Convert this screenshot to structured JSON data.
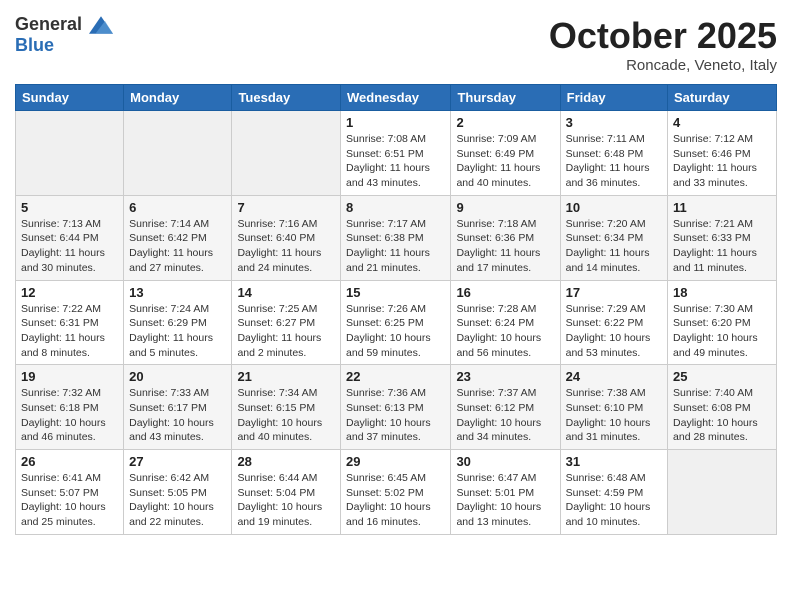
{
  "header": {
    "logo_line1": "General",
    "logo_line2": "Blue",
    "month": "October 2025",
    "location": "Roncade, Veneto, Italy"
  },
  "weekdays": [
    "Sunday",
    "Monday",
    "Tuesday",
    "Wednesday",
    "Thursday",
    "Friday",
    "Saturday"
  ],
  "weeks": [
    [
      {
        "day": "",
        "info": ""
      },
      {
        "day": "",
        "info": ""
      },
      {
        "day": "",
        "info": ""
      },
      {
        "day": "1",
        "info": "Sunrise: 7:08 AM\nSunset: 6:51 PM\nDaylight: 11 hours and 43 minutes."
      },
      {
        "day": "2",
        "info": "Sunrise: 7:09 AM\nSunset: 6:49 PM\nDaylight: 11 hours and 40 minutes."
      },
      {
        "day": "3",
        "info": "Sunrise: 7:11 AM\nSunset: 6:48 PM\nDaylight: 11 hours and 36 minutes."
      },
      {
        "day": "4",
        "info": "Sunrise: 7:12 AM\nSunset: 6:46 PM\nDaylight: 11 hours and 33 minutes."
      }
    ],
    [
      {
        "day": "5",
        "info": "Sunrise: 7:13 AM\nSunset: 6:44 PM\nDaylight: 11 hours and 30 minutes."
      },
      {
        "day": "6",
        "info": "Sunrise: 7:14 AM\nSunset: 6:42 PM\nDaylight: 11 hours and 27 minutes."
      },
      {
        "day": "7",
        "info": "Sunrise: 7:16 AM\nSunset: 6:40 PM\nDaylight: 11 hours and 24 minutes."
      },
      {
        "day": "8",
        "info": "Sunrise: 7:17 AM\nSunset: 6:38 PM\nDaylight: 11 hours and 21 minutes."
      },
      {
        "day": "9",
        "info": "Sunrise: 7:18 AM\nSunset: 6:36 PM\nDaylight: 11 hours and 17 minutes."
      },
      {
        "day": "10",
        "info": "Sunrise: 7:20 AM\nSunset: 6:34 PM\nDaylight: 11 hours and 14 minutes."
      },
      {
        "day": "11",
        "info": "Sunrise: 7:21 AM\nSunset: 6:33 PM\nDaylight: 11 hours and 11 minutes."
      }
    ],
    [
      {
        "day": "12",
        "info": "Sunrise: 7:22 AM\nSunset: 6:31 PM\nDaylight: 11 hours and 8 minutes."
      },
      {
        "day": "13",
        "info": "Sunrise: 7:24 AM\nSunset: 6:29 PM\nDaylight: 11 hours and 5 minutes."
      },
      {
        "day": "14",
        "info": "Sunrise: 7:25 AM\nSunset: 6:27 PM\nDaylight: 11 hours and 2 minutes."
      },
      {
        "day": "15",
        "info": "Sunrise: 7:26 AM\nSunset: 6:25 PM\nDaylight: 10 hours and 59 minutes."
      },
      {
        "day": "16",
        "info": "Sunrise: 7:28 AM\nSunset: 6:24 PM\nDaylight: 10 hours and 56 minutes."
      },
      {
        "day": "17",
        "info": "Sunrise: 7:29 AM\nSunset: 6:22 PM\nDaylight: 10 hours and 53 minutes."
      },
      {
        "day": "18",
        "info": "Sunrise: 7:30 AM\nSunset: 6:20 PM\nDaylight: 10 hours and 49 minutes."
      }
    ],
    [
      {
        "day": "19",
        "info": "Sunrise: 7:32 AM\nSunset: 6:18 PM\nDaylight: 10 hours and 46 minutes."
      },
      {
        "day": "20",
        "info": "Sunrise: 7:33 AM\nSunset: 6:17 PM\nDaylight: 10 hours and 43 minutes."
      },
      {
        "day": "21",
        "info": "Sunrise: 7:34 AM\nSunset: 6:15 PM\nDaylight: 10 hours and 40 minutes."
      },
      {
        "day": "22",
        "info": "Sunrise: 7:36 AM\nSunset: 6:13 PM\nDaylight: 10 hours and 37 minutes."
      },
      {
        "day": "23",
        "info": "Sunrise: 7:37 AM\nSunset: 6:12 PM\nDaylight: 10 hours and 34 minutes."
      },
      {
        "day": "24",
        "info": "Sunrise: 7:38 AM\nSunset: 6:10 PM\nDaylight: 10 hours and 31 minutes."
      },
      {
        "day": "25",
        "info": "Sunrise: 7:40 AM\nSunset: 6:08 PM\nDaylight: 10 hours and 28 minutes."
      }
    ],
    [
      {
        "day": "26",
        "info": "Sunrise: 6:41 AM\nSunset: 5:07 PM\nDaylight: 10 hours and 25 minutes."
      },
      {
        "day": "27",
        "info": "Sunrise: 6:42 AM\nSunset: 5:05 PM\nDaylight: 10 hours and 22 minutes."
      },
      {
        "day": "28",
        "info": "Sunrise: 6:44 AM\nSunset: 5:04 PM\nDaylight: 10 hours and 19 minutes."
      },
      {
        "day": "29",
        "info": "Sunrise: 6:45 AM\nSunset: 5:02 PM\nDaylight: 10 hours and 16 minutes."
      },
      {
        "day": "30",
        "info": "Sunrise: 6:47 AM\nSunset: 5:01 PM\nDaylight: 10 hours and 13 minutes."
      },
      {
        "day": "31",
        "info": "Sunrise: 6:48 AM\nSunset: 4:59 PM\nDaylight: 10 hours and 10 minutes."
      },
      {
        "day": "",
        "info": ""
      }
    ]
  ]
}
